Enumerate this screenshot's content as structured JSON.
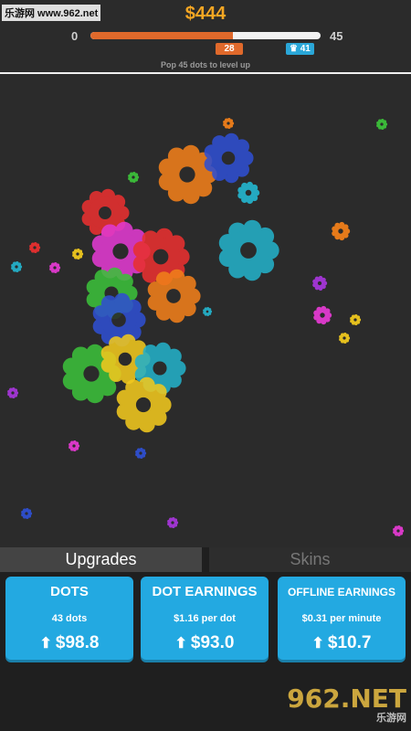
{
  "watermark": "乐游网 www.962.net",
  "header": {
    "money": "$444",
    "level_start": "0",
    "level_end": "45",
    "progress_fraction": 0.62,
    "badge_current": "28",
    "badge_target": "41",
    "badge_target_icon": "crown-icon",
    "hint": "Pop 45 dots to level up"
  },
  "colors": {
    "money": "#f5a623",
    "progress": "#e0692b",
    "target_badge": "#2aa7d8",
    "card": "#23a9e1",
    "splat_palette": [
      "#e83030",
      "#e23ad0",
      "#f07f1a",
      "#2f4fd0",
      "#24b0c8",
      "#3cc03a",
      "#f0c81e",
      "#a536d8"
    ]
  },
  "play_area": {
    "splats": [
      {
        "color": "#f07f1a",
        "size": "large"
      },
      {
        "color": "#2f4fd0",
        "size": "large"
      },
      {
        "color": "#e83030",
        "size": "large"
      },
      {
        "color": "#e23ad0",
        "size": "large"
      },
      {
        "color": "#24b0c8",
        "size": "large"
      },
      {
        "color": "#3cc03a",
        "size": "large"
      },
      {
        "color": "#f0c81e",
        "size": "large"
      }
    ]
  },
  "tabs": {
    "upgrades": "Upgrades",
    "skins": "Skins"
  },
  "cards": [
    {
      "title": "DOTS",
      "sub": "43 dots",
      "price": "$98.8"
    },
    {
      "title": "DOT EARNINGS",
      "sub": "$1.16 per dot",
      "price": "$93.0"
    },
    {
      "title": "OFFLINE EARNINGS",
      "sub": "$0.31 per minute",
      "price": "$10.7"
    }
  ],
  "footer": {
    "logo_text": "962.NET",
    "logo_sub": "乐游网"
  }
}
